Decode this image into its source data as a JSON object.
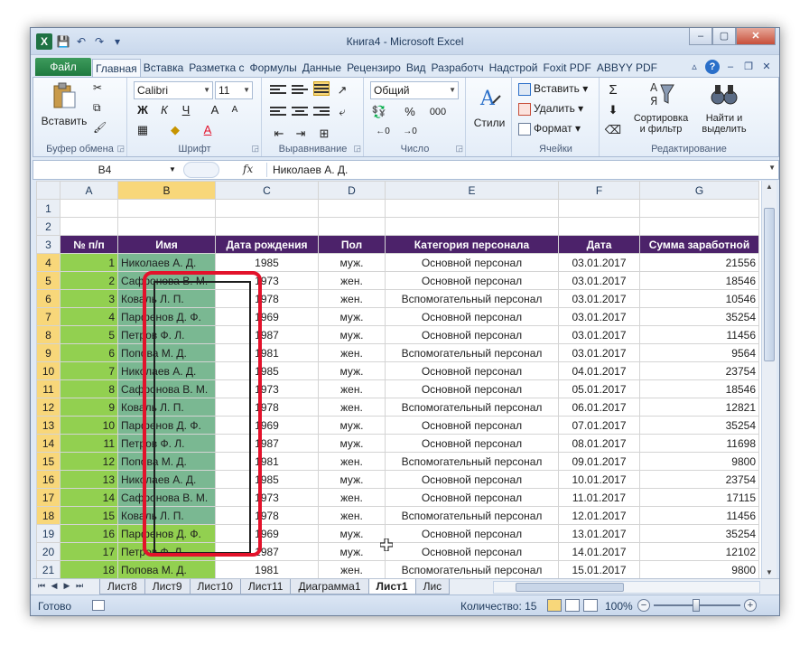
{
  "window": {
    "title": "Книга4 - Microsoft Excel",
    "app_icon": "X",
    "buttons": {
      "minimize": "–",
      "maximize": "▢",
      "close": "✕"
    }
  },
  "qat": [
    "save-icon",
    "undo-icon",
    "redo-icon",
    "customize-icon"
  ],
  "ribbon_tabs": {
    "file": "Файл",
    "tabs": [
      "Главная",
      "Вставка",
      "Разметка с",
      "Формулы",
      "Данные",
      "Рецензиро",
      "Вид",
      "Разработч",
      "Надстрой",
      "Foxit PDF",
      "ABBYY PDF"
    ],
    "active": "Главная"
  },
  "ribbon": {
    "clipboard": {
      "label": "Буфер обмена",
      "paste": "Вставить"
    },
    "font": {
      "label": "Шрифт",
      "name": "Calibri",
      "size": "11",
      "bold": "Ж",
      "italic": "К",
      "underline": "Ч",
      "grow": "A",
      "shrink": "A",
      "font_color": "A"
    },
    "alignment": {
      "label": "Выравнивание"
    },
    "number": {
      "label": "Число",
      "format": "Общий",
      "percent": "%",
      "thousands": "000"
    },
    "styles": {
      "label": "Стили",
      "button": "Стили"
    },
    "cells": {
      "label": "Ячейки",
      "insert": "Вставить",
      "delete": "Удалить",
      "format": "Формат"
    },
    "editing": {
      "label": "Редактирование",
      "sum": "Σ",
      "sort": "Сортировка",
      "sort2": "и фильтр",
      "find": "Найти и",
      "find2": "выделить"
    }
  },
  "formula_bar": {
    "name_box": "B4",
    "fx": "fx",
    "value": "Николаев А. Д."
  },
  "columns": [
    "A",
    "B",
    "C",
    "D",
    "E",
    "F",
    "G"
  ],
  "selected_column": "B",
  "header_row": [
    "№ п/п",
    "Имя",
    "Дата рождения",
    "Пол",
    "Категория персонала",
    "Дата",
    "Сумма заработной"
  ],
  "rows": [
    {
      "n": "1",
      "name": "Николаев А. Д.",
      "year": "1985",
      "sex": "муж.",
      "cat": "Основной персонал",
      "date": "03.01.2017",
      "sum": "21556"
    },
    {
      "n": "2",
      "name": "Сафронова В. М.",
      "year": "1973",
      "sex": "жен.",
      "cat": "Основной персонал",
      "date": "03.01.2017",
      "sum": "18546"
    },
    {
      "n": "3",
      "name": "Коваль Л. П.",
      "year": "1978",
      "sex": "жен.",
      "cat": "Вспомогательный персонал",
      "date": "03.01.2017",
      "sum": "10546"
    },
    {
      "n": "4",
      "name": "Парфенов Д. Ф.",
      "year": "1969",
      "sex": "муж.",
      "cat": "Основной персонал",
      "date": "03.01.2017",
      "sum": "35254"
    },
    {
      "n": "5",
      "name": "Петров Ф. Л.",
      "year": "1987",
      "sex": "муж.",
      "cat": "Основной персонал",
      "date": "03.01.2017",
      "sum": "11456"
    },
    {
      "n": "6",
      "name": "Попова М. Д.",
      "year": "1981",
      "sex": "жен.",
      "cat": "Вспомогательный персонал",
      "date": "03.01.2017",
      "sum": "9564"
    },
    {
      "n": "7",
      "name": "Николаев А. Д.",
      "year": "1985",
      "sex": "муж.",
      "cat": "Основной персонал",
      "date": "04.01.2017",
      "sum": "23754"
    },
    {
      "n": "8",
      "name": "Сафронова В. М.",
      "year": "1973",
      "sex": "жен.",
      "cat": "Основной персонал",
      "date": "05.01.2017",
      "sum": "18546"
    },
    {
      "n": "9",
      "name": "Коваль Л. П.",
      "year": "1978",
      "sex": "жен.",
      "cat": "Вспомогательный персонал",
      "date": "06.01.2017",
      "sum": "12821"
    },
    {
      "n": "10",
      "name": "Парфенов Д. Ф.",
      "year": "1969",
      "sex": "муж.",
      "cat": "Основной персонал",
      "date": "07.01.2017",
      "sum": "35254"
    },
    {
      "n": "11",
      "name": "Петров Ф. Л.",
      "year": "1987",
      "sex": "муж.",
      "cat": "Основной персонал",
      "date": "08.01.2017",
      "sum": "11698"
    },
    {
      "n": "12",
      "name": "Попова М. Д.",
      "year": "1981",
      "sex": "жен.",
      "cat": "Вспомогательный персонал",
      "date": "09.01.2017",
      "sum": "9800"
    },
    {
      "n": "13",
      "name": "Николаев А. Д.",
      "year": "1985",
      "sex": "муж.",
      "cat": "Основной персонал",
      "date": "10.01.2017",
      "sum": "23754"
    },
    {
      "n": "14",
      "name": "Сафронова В. М.",
      "year": "1973",
      "sex": "жен.",
      "cat": "Основной персонал",
      "date": "11.01.2017",
      "sum": "17115"
    },
    {
      "n": "15",
      "name": "Коваль Л. П.",
      "year": "1978",
      "sex": "жен.",
      "cat": "Вспомогательный персонал",
      "date": "12.01.2017",
      "sum": "11456"
    },
    {
      "n": "16",
      "name": "Парфенов Д. Ф.",
      "year": "1969",
      "sex": "муж.",
      "cat": "Основной персонал",
      "date": "13.01.2017",
      "sum": "35254"
    },
    {
      "n": "17",
      "name": "Петров Ф. Л.",
      "year": "1987",
      "sex": "муж.",
      "cat": "Основной персонал",
      "date": "14.01.2017",
      "sum": "12102"
    },
    {
      "n": "18",
      "name": "Попова М. Д.",
      "year": "1981",
      "sex": "жен.",
      "cat": "Вспомогательный персонал",
      "date": "15.01.2017",
      "sum": "9800"
    }
  ],
  "sheet_tabs": [
    "Лист8",
    "Лист9",
    "Лист10",
    "Лист11",
    "Диаграмма1",
    "Лист1",
    "Лис"
  ],
  "active_sheet": "Лист1",
  "status": {
    "ready": "Готово",
    "count": "Количество: 15",
    "zoom": "100%",
    "zoom_minus": "−",
    "zoom_plus": "+"
  },
  "colors": {
    "header_bg": "#4c226a",
    "cell_green": "#92d050",
    "selection_green": "#7ab892",
    "highlight_red": "#e3122b",
    "selected_header": "#f8d77a"
  }
}
